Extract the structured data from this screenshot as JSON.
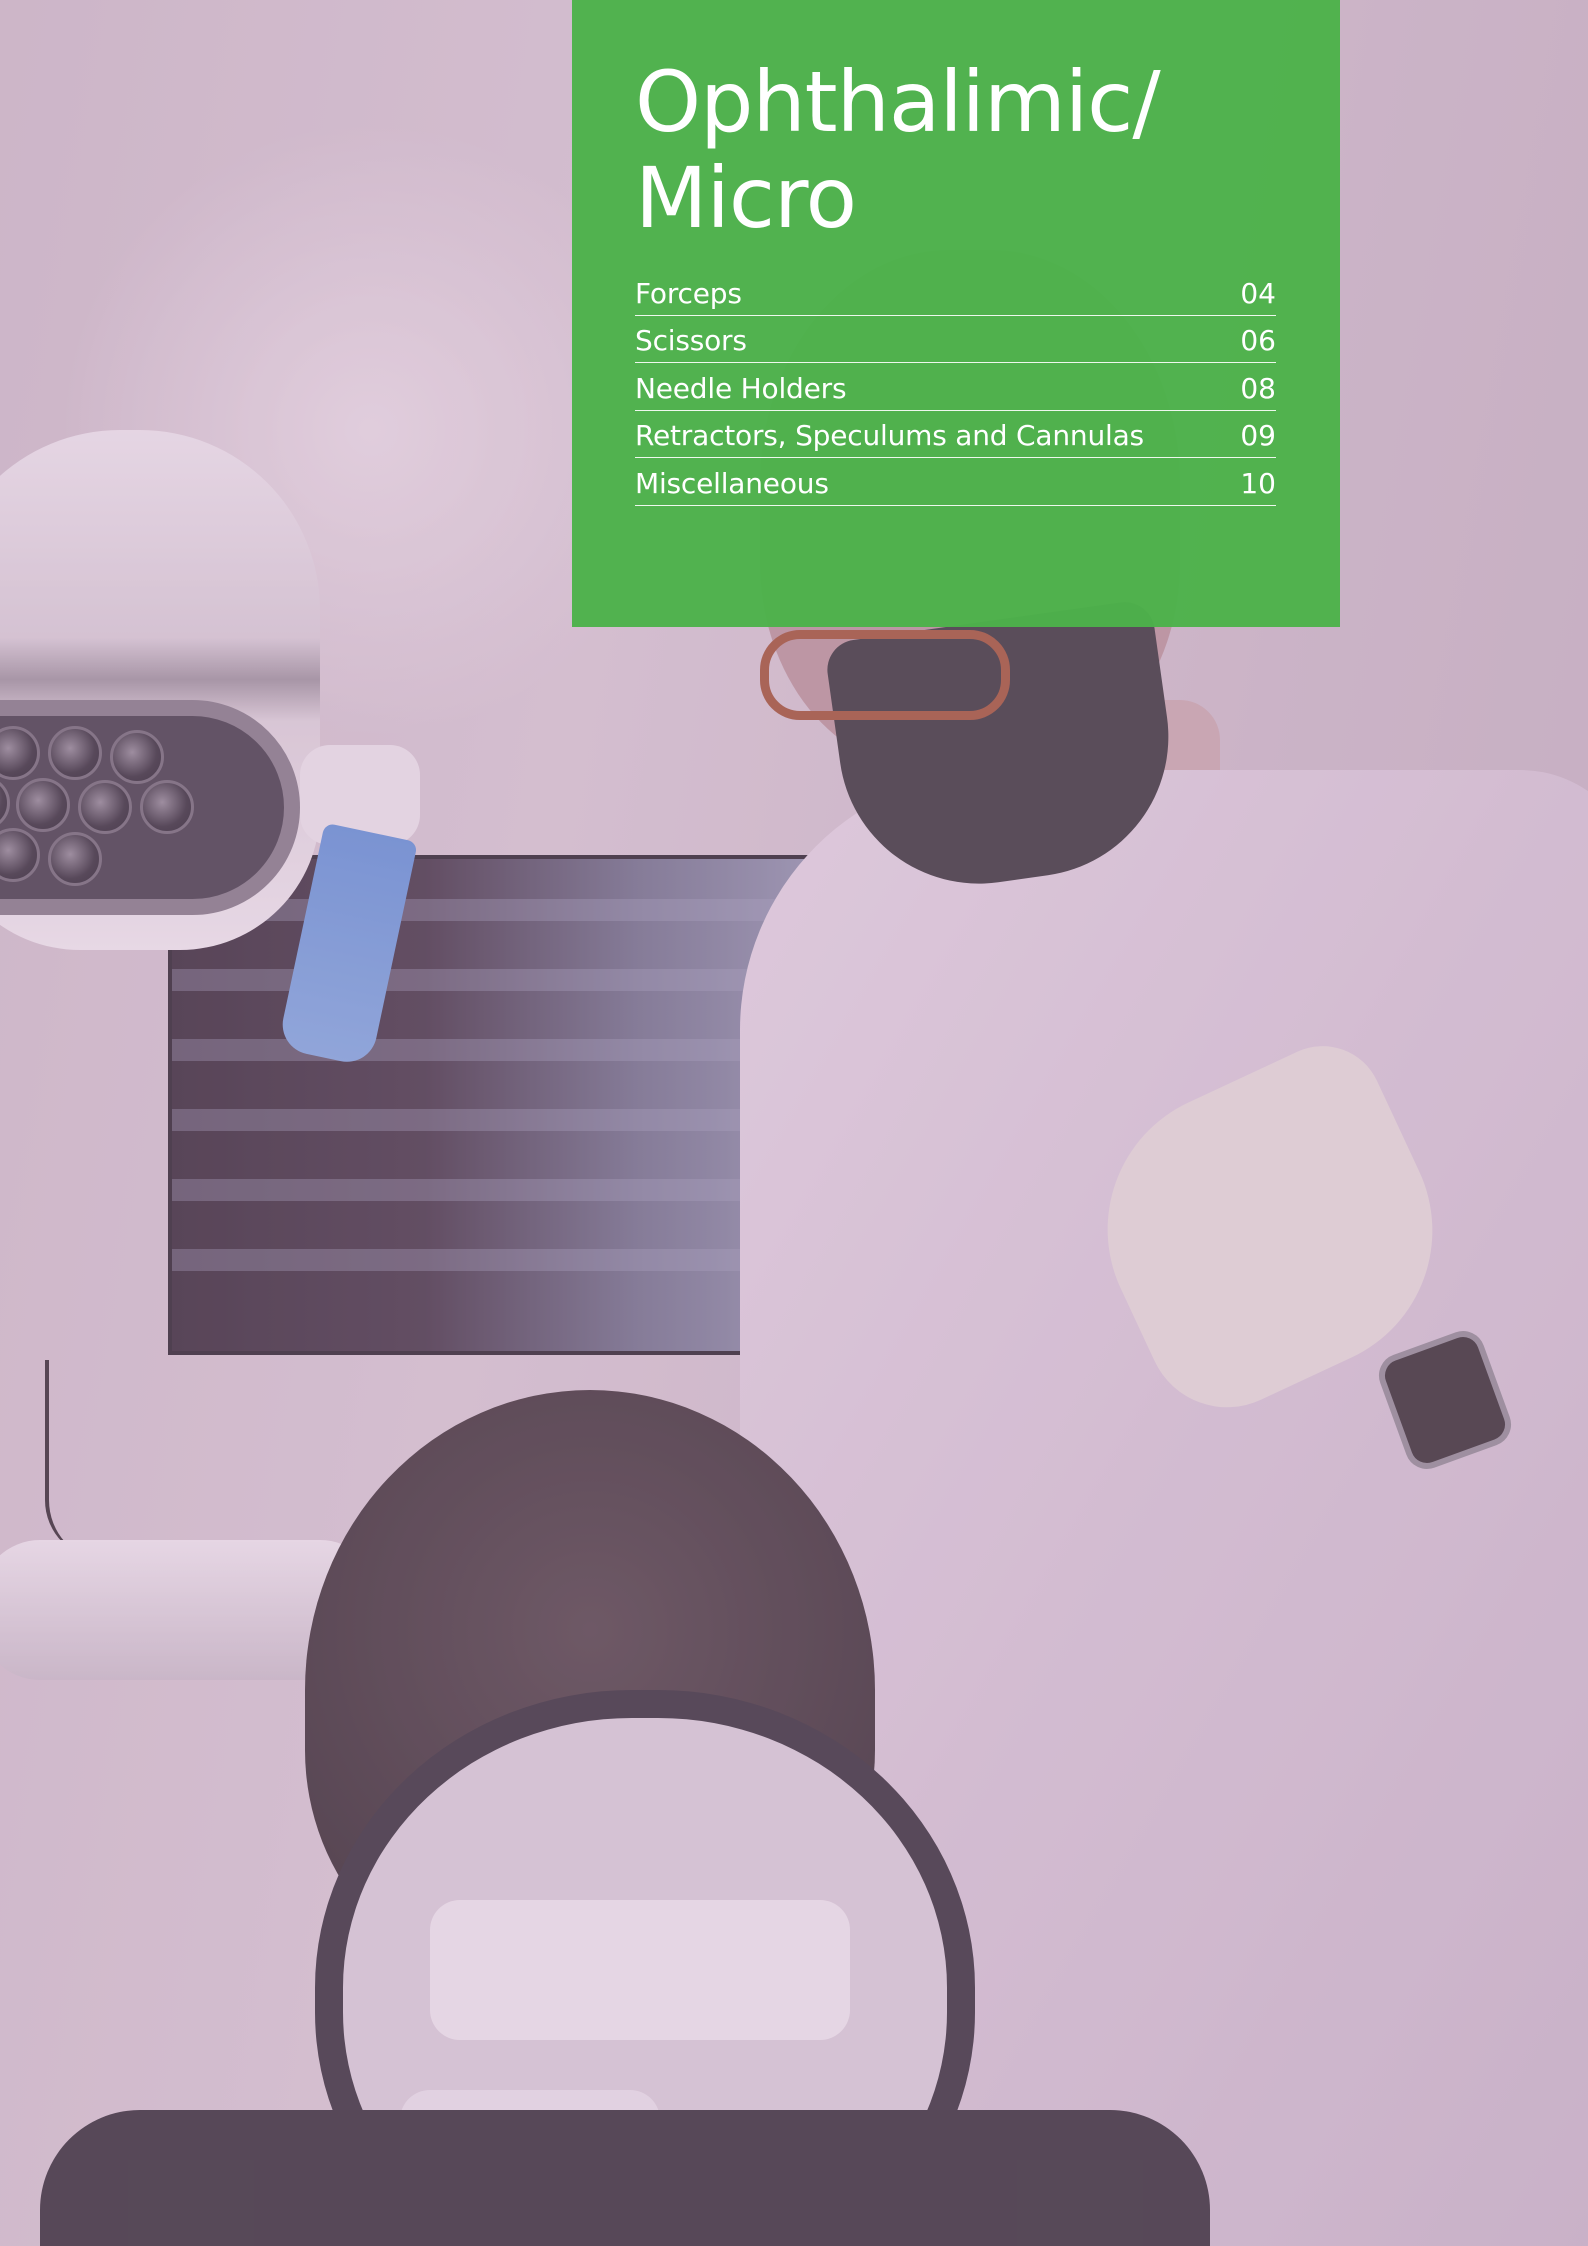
{
  "brand_colors": {
    "panel_green": "#4cb24a",
    "text": "#ffffff"
  },
  "section": {
    "title": "Ophthalimic/\nMicro"
  },
  "contents": [
    {
      "label": "Forceps",
      "page": "04"
    },
    {
      "label": "Scissors",
      "page": "06"
    },
    {
      "label": "Needle Holders",
      "page": "08"
    },
    {
      "label": "Retractors, Speculums and Cannulas",
      "page": "09"
    },
    {
      "label": "Miscellaneous",
      "page": "10"
    }
  ]
}
